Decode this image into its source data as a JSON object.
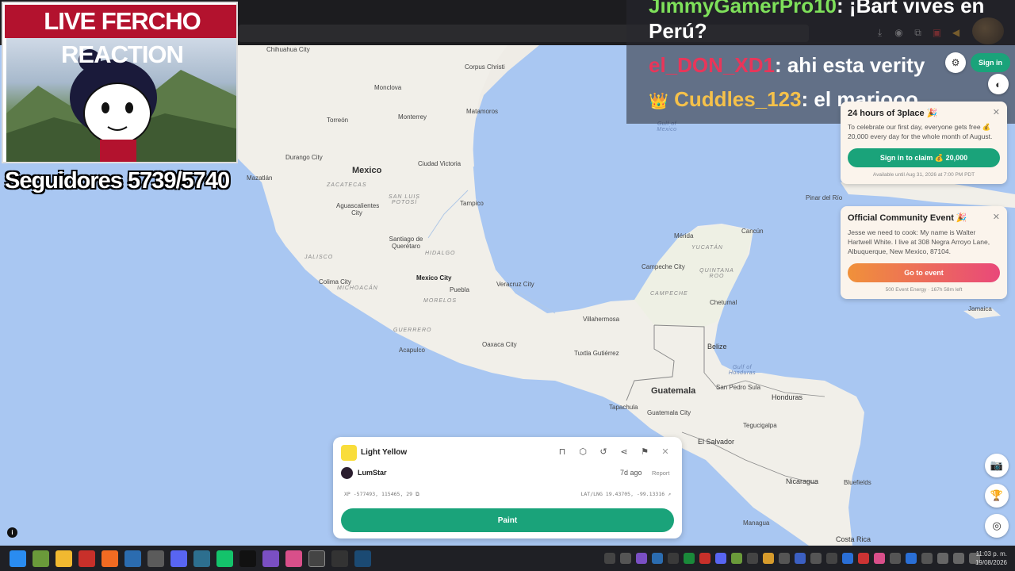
{
  "stream": {
    "title": "LIVE FERCHO REACTION",
    "followers": "Seguidores 5739/5740"
  },
  "chat": {
    "messages": [
      {
        "user": "JimmyGamerPro10",
        "user_color": "#7ee05a",
        "text": ": ¡Bart vives en",
        "cont": "Perú?"
      },
      {
        "user": "el_DON_XD1",
        "user_color": "#e8365a",
        "text": ": ahi esta verity"
      },
      {
        "user": "Cuddles_123",
        "user_color": "#f5c14a",
        "text": ": el mariooo",
        "badge": "👑"
      }
    ]
  },
  "header": {
    "signin_label": "Sign in",
    "settings_icon": "gear-icon"
  },
  "cards": {
    "promo": {
      "title": "24 hours of 3place 🎉",
      "body": "To celebrate our first day, everyone gets free 💰 20,000 every day for the whole month of August.",
      "button": "Sign in to claim 💰 20,000",
      "footer": "Available until Aug 31, 2026 at 7:00 PM PDT",
      "button_color": "#1aa37a"
    },
    "event": {
      "title": "Official Community Event 🎉",
      "body": "Jesse we need to cook: My name is Walter Hartwell White. I live at 308 Negra Arroyo Lane, Albuquerque, New Mexico, 87104.",
      "button": "Go to event",
      "footer": "500 Event Energy · 167h 58m left"
    }
  },
  "pixel": {
    "color_name": "Light Yellow",
    "color_hex": "#f9dd3b",
    "user": "LumStar",
    "time_ago": "7d ago",
    "report": "Report",
    "coords_px": "XP -577493, 115465, 29",
    "coords_latlng": "LAT/LNG 19.43705, -99.13316",
    "paint_label": "Paint"
  },
  "map": {
    "labels": [
      {
        "text": "Chihuahua City",
        "cls": ""
      },
      {
        "text": "Monclova",
        "cls": ""
      },
      {
        "text": "Corpus Christi",
        "cls": ""
      },
      {
        "text": "Torreón",
        "cls": ""
      },
      {
        "text": "Monterrey",
        "cls": ""
      },
      {
        "text": "Matamoros",
        "cls": ""
      },
      {
        "text": "Durango City",
        "cls": ""
      },
      {
        "text": "Mexico",
        "cls": "big"
      },
      {
        "text": "Ciudad Victoria",
        "cls": ""
      },
      {
        "text": "Mazatlán",
        "cls": ""
      },
      {
        "text": "ZACATECAS",
        "cls": "state"
      },
      {
        "text": "SAN LUIS POTOSÍ",
        "cls": "state"
      },
      {
        "text": "Tampico",
        "cls": ""
      },
      {
        "text": "Aguascalientes City",
        "cls": ""
      },
      {
        "text": "Santiago de Querétaro",
        "cls": ""
      },
      {
        "text": "JALISCO",
        "cls": "state"
      },
      {
        "text": "HIDALGO",
        "cls": "state"
      },
      {
        "text": "Colima City",
        "cls": ""
      },
      {
        "text": "Mexico City",
        "cls": "bold"
      },
      {
        "text": "Puebla",
        "cls": ""
      },
      {
        "text": "Veracruz City",
        "cls": ""
      },
      {
        "text": "MICHOACÁN",
        "cls": "state"
      },
      {
        "text": "MORELOS",
        "cls": "state"
      },
      {
        "text": "GUERRERO",
        "cls": "state"
      },
      {
        "text": "Acapulco",
        "cls": ""
      },
      {
        "text": "Oaxaca City",
        "cls": ""
      },
      {
        "text": "Villahermosa",
        "cls": ""
      },
      {
        "text": "Tuxtla Gutiérrez",
        "cls": ""
      },
      {
        "text": "Mérida",
        "cls": ""
      },
      {
        "text": "Cancún",
        "cls": ""
      },
      {
        "text": "YUCATÁN",
        "cls": "state"
      },
      {
        "text": "Campeche City",
        "cls": ""
      },
      {
        "text": "QUINTANA ROO",
        "cls": "state"
      },
      {
        "text": "CAMPECHE",
        "cls": "state"
      },
      {
        "text": "Chetumal",
        "cls": ""
      },
      {
        "text": "Belize",
        "cls": ""
      },
      {
        "text": "Guatemala",
        "cls": "big"
      },
      {
        "text": "Guatemala City",
        "cls": ""
      },
      {
        "text": "Tapachula",
        "cls": ""
      },
      {
        "text": "San Pedro Sula",
        "cls": ""
      },
      {
        "text": "Honduras",
        "cls": ""
      },
      {
        "text": "Tegucigalpa",
        "cls": ""
      },
      {
        "text": "El Salvador",
        "cls": ""
      },
      {
        "text": "Managua",
        "cls": ""
      },
      {
        "text": "Nicaragua",
        "cls": ""
      },
      {
        "text": "Bluefields",
        "cls": ""
      },
      {
        "text": "Costa Rica",
        "cls": ""
      },
      {
        "text": "Pinar del Río",
        "cls": ""
      },
      {
        "text": "Jamaica",
        "cls": ""
      },
      {
        "text": "Gulf of Mexico",
        "cls": "sea"
      },
      {
        "text": "Gulf of Honduras",
        "cls": "sea"
      }
    ]
  },
  "taskbar": {
    "time": "11:03 p. m.",
    "date": "19/08/2026"
  }
}
